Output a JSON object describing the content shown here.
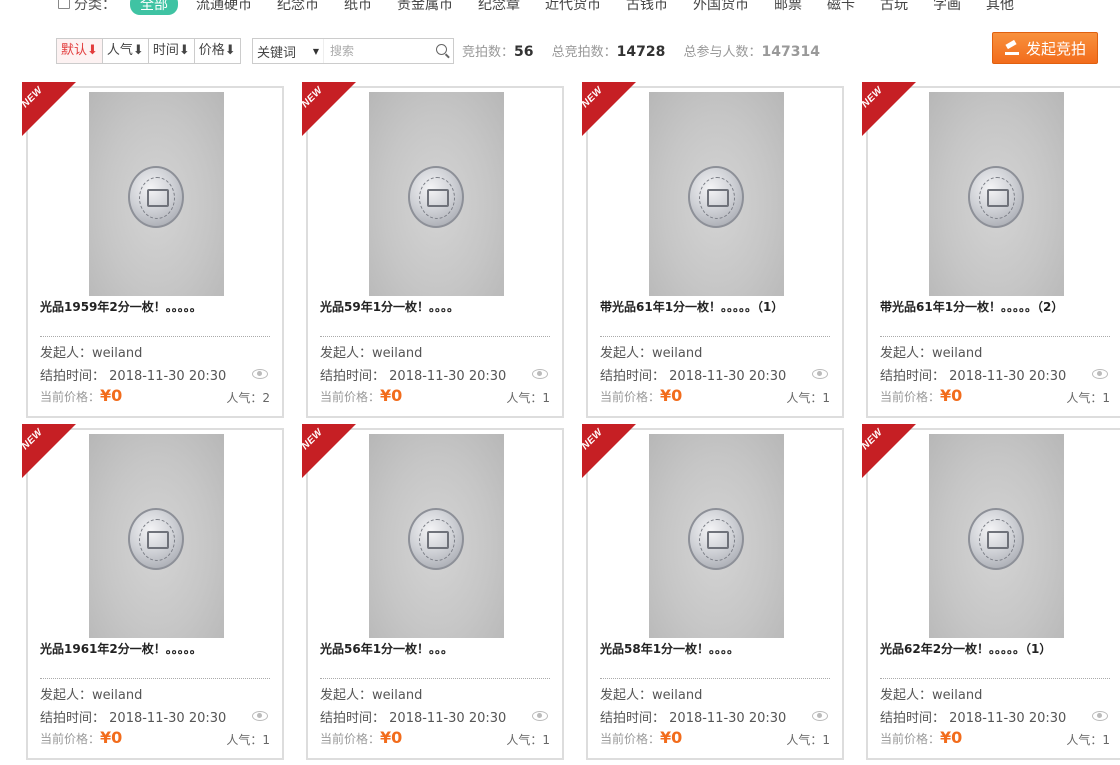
{
  "categories": {
    "label": "分类：",
    "icon": "category-icon",
    "items": [
      "全部",
      "流通硬币",
      "纪念币",
      "纸币",
      "贵金属币",
      "纪念章",
      "近代货币",
      "古钱币",
      "外国货币",
      "邮票",
      "磁卡",
      "古玩",
      "字画",
      "其他"
    ],
    "active_index": 0
  },
  "sort": {
    "buttons": [
      "默认⬇",
      "人气⬇",
      "时间⬇",
      "价格⬇"
    ],
    "active_index": 0
  },
  "search": {
    "field_select": "关键词",
    "placeholder": "搜索"
  },
  "stats": {
    "auction_label": "竞拍数：",
    "auction_count": "56",
    "total_label": "总竞拍数：",
    "total_count": "14728",
    "people_label": "总参与人数：",
    "people_count": "147314"
  },
  "launch_button": "发起竞拍",
  "colors": {
    "accent_green": "#3fc3a3",
    "accent_orange": "#f26c1c",
    "ribbon_red": "#c61f24"
  },
  "labels": {
    "ribbon": "NEW",
    "creator": "发起人：",
    "end_time": "结拍时间：",
    "price": "当前价格：",
    "popularity": "人气："
  },
  "cards": [
    {
      "title": "光品1959年2分一枚！。。。。。",
      "creator": "weiland",
      "end_time": "2018-11-30 20:30",
      "price": "¥0",
      "popularity": "2"
    },
    {
      "title": "光品59年1分一枚！。。。。",
      "creator": "weiland",
      "end_time": "2018-11-30 20:30",
      "price": "¥0",
      "popularity": "1"
    },
    {
      "title": "带光品61年1分一枚！。。。。。（1）",
      "creator": "weiland",
      "end_time": "2018-11-30 20:30",
      "price": "¥0",
      "popularity": "1"
    },
    {
      "title": "带光品61年1分一枚！。。。。。（2）",
      "creator": "weiland",
      "end_time": "2018-11-30 20:30",
      "price": "¥0",
      "popularity": "1"
    },
    {
      "title": "光品1961年2分一枚！。。。。。",
      "creator": "weiland",
      "end_time": "2018-11-30 20:30",
      "price": "¥0",
      "popularity": "1"
    },
    {
      "title": "光品56年1分一枚！。。。",
      "creator": "weiland",
      "end_time": "2018-11-30 20:30",
      "price": "¥0",
      "popularity": "1"
    },
    {
      "title": "光品58年1分一枚！。。。。",
      "creator": "weiland",
      "end_time": "2018-11-30 20:30",
      "price": "¥0",
      "popularity": "1"
    },
    {
      "title": "光品62年2分一枚！。。。。。（1）",
      "creator": "weiland",
      "end_time": "2018-11-30 20:30",
      "price": "¥0",
      "popularity": "1"
    }
  ]
}
